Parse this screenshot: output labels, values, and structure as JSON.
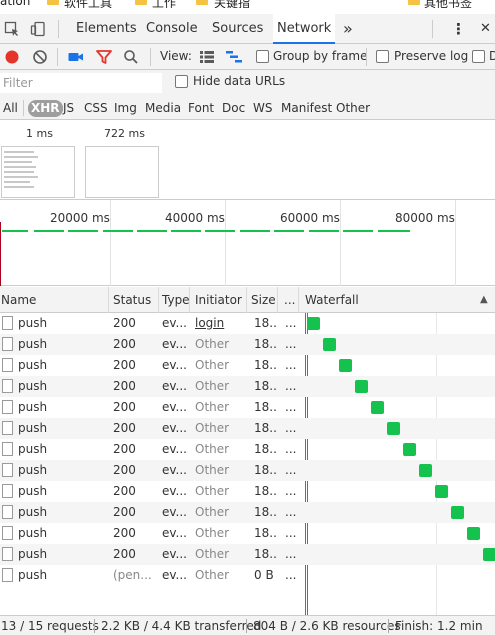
{
  "bookmarks": {
    "items": [
      "ation",
      "软件工具",
      "工作",
      "关键指",
      "其他书签"
    ]
  },
  "devtools": {
    "tabs": [
      "Elements",
      "Console",
      "Sources",
      "Network"
    ],
    "active_tab": "Network",
    "more_tabs_symbol": "»",
    "menu_symbol": "⋮",
    "close_symbol": "✕"
  },
  "toolbar": {
    "view_label": "View:",
    "group_by_frame": "Group by frame",
    "preserve_log": "Preserve log",
    "disable_cache_truncated": "D",
    "record_color": "#e5352b",
    "filter_icon_color": "#e5352b"
  },
  "filter": {
    "placeholder": "Filter",
    "hide_data_urls": "Hide data URLs"
  },
  "types": {
    "items": [
      "All",
      "XHR",
      "JS",
      "CSS",
      "Img",
      "Media",
      "Font",
      "Doc",
      "WS",
      "Manifest",
      "Other"
    ],
    "active": "XHR"
  },
  "screenshots": {
    "times": [
      "1 ms",
      "722 ms"
    ]
  },
  "overview": {
    "labels": [
      "20000 ms",
      "40000 ms",
      "60000 ms",
      "80000 ms"
    ],
    "bar_color": "#14c24d"
  },
  "table": {
    "headers": {
      "name": "Name",
      "status": "Status",
      "type": "Type",
      "initiator": "Initiator",
      "size": "Size",
      "time": "...",
      "waterfall": "Waterfall"
    },
    "sort_indicator": "▲",
    "rows": [
      {
        "name": "push",
        "status": "200",
        "type": "ev...",
        "initiator": "login",
        "size": "18...",
        "time": "..."
      },
      {
        "name": "push",
        "status": "200",
        "type": "ev...",
        "initiator": "Other",
        "size": "18...",
        "time": "..."
      },
      {
        "name": "push",
        "status": "200",
        "type": "ev...",
        "initiator": "Other",
        "size": "18...",
        "time": "..."
      },
      {
        "name": "push",
        "status": "200",
        "type": "ev...",
        "initiator": "Other",
        "size": "18...",
        "time": "..."
      },
      {
        "name": "push",
        "status": "200",
        "type": "ev...",
        "initiator": "Other",
        "size": "18...",
        "time": "..."
      },
      {
        "name": "push",
        "status": "200",
        "type": "ev...",
        "initiator": "Other",
        "size": "18...",
        "time": "..."
      },
      {
        "name": "push",
        "status": "200",
        "type": "ev...",
        "initiator": "Other",
        "size": "18...",
        "time": "..."
      },
      {
        "name": "push",
        "status": "200",
        "type": "ev...",
        "initiator": "Other",
        "size": "18...",
        "time": "..."
      },
      {
        "name": "push",
        "status": "200",
        "type": "ev...",
        "initiator": "Other",
        "size": "18...",
        "time": "..."
      },
      {
        "name": "push",
        "status": "200",
        "type": "ev...",
        "initiator": "Other",
        "size": "18...",
        "time": "..."
      },
      {
        "name": "push",
        "status": "200",
        "type": "ev...",
        "initiator": "Other",
        "size": "18...",
        "time": "..."
      },
      {
        "name": "push",
        "status": "200",
        "type": "ev...",
        "initiator": "Other",
        "size": "18...",
        "time": "..."
      },
      {
        "name": "push",
        "status": "(pen...",
        "type": "ev...",
        "initiator": "Other",
        "size": "0 B",
        "time": "..."
      }
    ],
    "waterfall_color": "#14c24d"
  },
  "status_bar": {
    "requests": "13 / 15 requests",
    "transferred": "2.2 KB / 4.4 KB transferred",
    "resources": "804 B / 2.6 KB resources",
    "finish": "Finish: 1.2 min"
  }
}
